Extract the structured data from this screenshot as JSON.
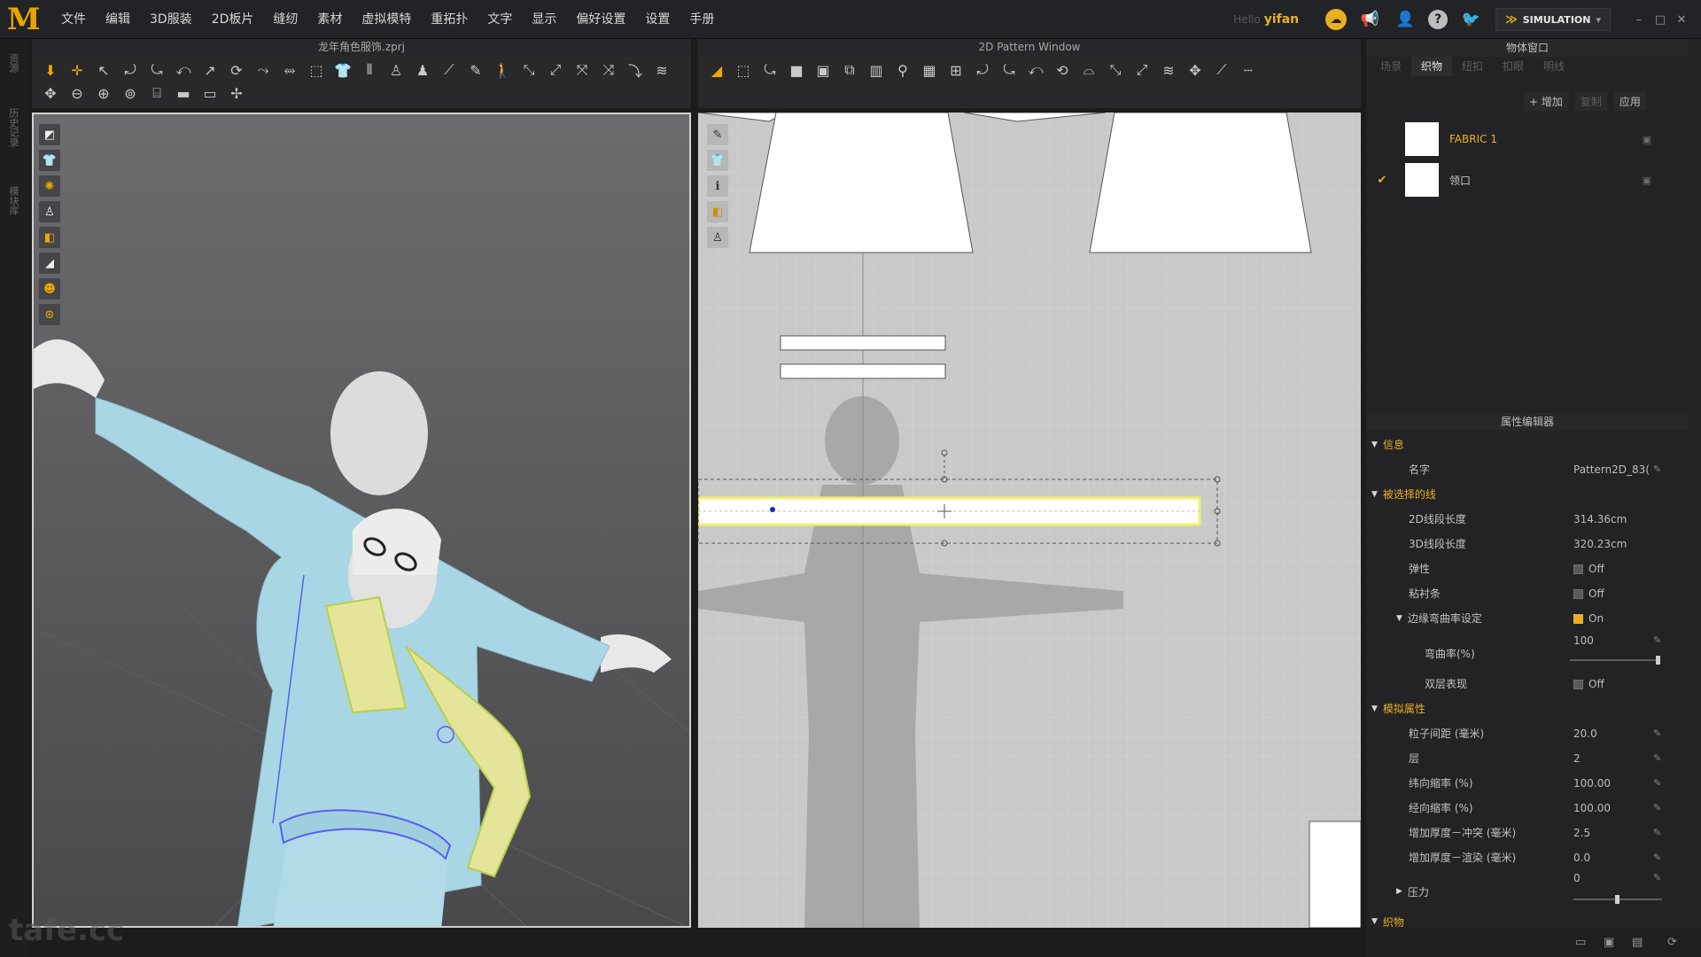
{
  "app": {
    "logo": "M",
    "menu": [
      "文件",
      "编辑",
      "3D服装",
      "2D板片",
      "缝纫",
      "素材",
      "虚拟模特",
      "重拓扑",
      "文字",
      "显示",
      "偏好设置",
      "设置",
      "手册"
    ],
    "hello": "Hello",
    "username": "yifan",
    "mode": "SIMULATION"
  },
  "left_strip": {
    "tabs": [
      "资源",
      "历史记录",
      "模块库"
    ]
  },
  "viewport3d": {
    "title": "龙年角色服饰.zprj"
  },
  "viewport2d": {
    "title": "2D Pattern Window"
  },
  "object_window": {
    "title": "物体窗口",
    "tabs": [
      "场景",
      "织物",
      "纽扣",
      "扣眼",
      "明线"
    ],
    "active_tab": "织物",
    "actions": {
      "add": "+ 增加",
      "copy": "复制",
      "apply": "应用"
    },
    "fabrics": [
      {
        "name": "FABRIC 1",
        "selected": false,
        "checked": false
      },
      {
        "name": "领口",
        "selected": true,
        "checked": true
      }
    ]
  },
  "property_editor": {
    "title": "属性编辑器",
    "info_group": "信息",
    "name_label": "名字",
    "name_value": "Pattern2D_83(",
    "selected_line_group": "被选择的线",
    "len2d_label": "2D线段长度",
    "len2d_value": "314.36cm",
    "len3d_label": "3D线段长度",
    "len3d_value": "320.23cm",
    "elastic_label": "弹性",
    "elastic_value": "Off",
    "tape_label": "粘衬条",
    "tape_value": "Off",
    "curve_label": "边缘弯曲率设定",
    "curve_value": "On",
    "curvature_label": "弯曲率(%)",
    "curvature_value": "100",
    "curvature_fraction": 1.0,
    "double_label": "双层表现",
    "double_value": "Off",
    "sim_group": "模拟属性",
    "particle_label": "粒子间距 (毫米)",
    "particle_value": "20.0",
    "layer_label": "层",
    "layer_value": "2",
    "weft_label": "纬向缩率 (%)",
    "weft_value": "100.00",
    "warp_label": "经向缩率 (%)",
    "warp_value": "100.00",
    "thick_coll_label": "增加厚度－冲突 (毫米)",
    "thick_coll_value": "2.5",
    "thick_render_label": "增加厚度－渲染 (毫米)",
    "thick_render_value": "0.0",
    "pressure_label": "压力",
    "pressure_value": "0",
    "pressure_fraction": 0.5,
    "fabric_group": "织物"
  },
  "watermark": "tafe.cc",
  "colors": {
    "accent": "#e8b020",
    "garment": "#a9d6e4",
    "selected_edge": "#ffff00"
  }
}
